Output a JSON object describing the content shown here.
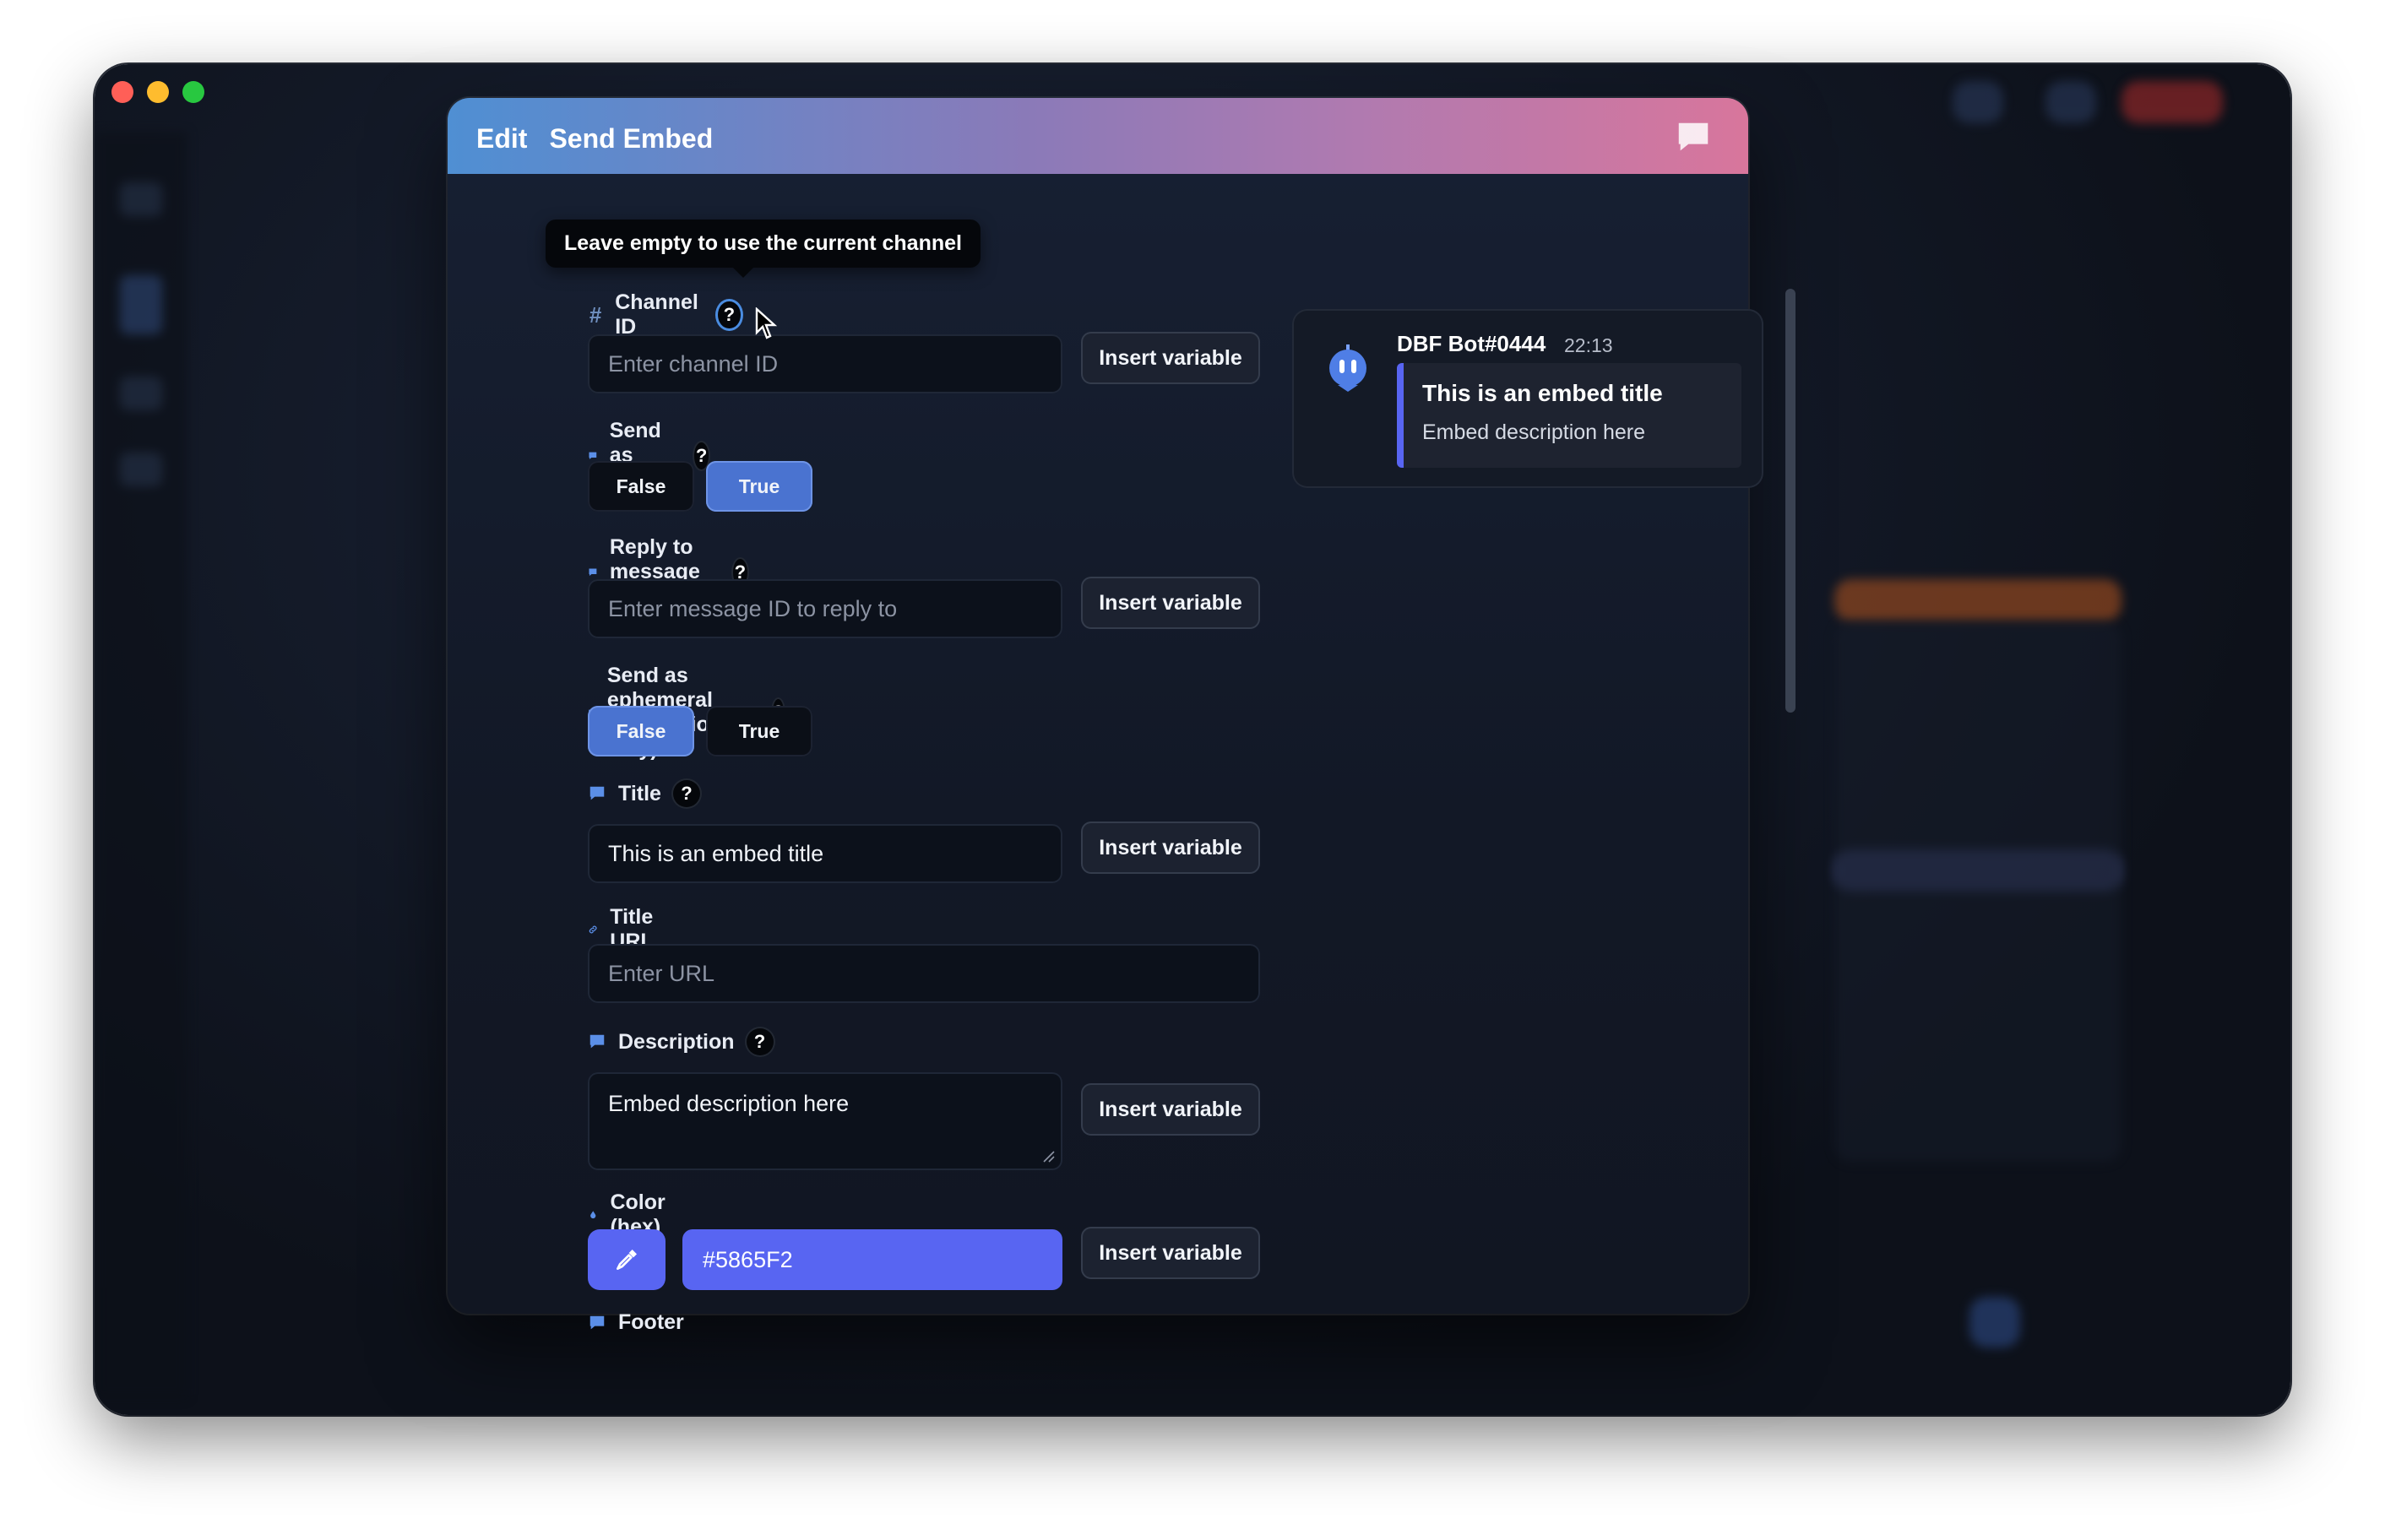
{
  "modal": {
    "title_action": "Edit",
    "title_name": "Send Embed",
    "tooltip": "Leave empty to use the current channel"
  },
  "fields": {
    "channel_id": {
      "label": "Channel ID",
      "placeholder": "Enter channel ID"
    },
    "send_as_reply": {
      "label": "Send as reply",
      "options": [
        "False",
        "True"
      ],
      "selected": "True"
    },
    "reply_message_id": {
      "label": "Reply to message ID",
      "placeholder": "Enter message ID to reply to"
    },
    "ephemeral": {
      "label": "Send as ephemeral (interactions only)",
      "options": [
        "False",
        "True"
      ],
      "selected": "False"
    },
    "title": {
      "label": "Title",
      "value": "This is an embed title"
    },
    "title_url": {
      "label": "Title URL",
      "placeholder": "Enter URL"
    },
    "description": {
      "label": "Description",
      "value": "Embed description here"
    },
    "color": {
      "label": "Color (hex)",
      "value": "#5865F2"
    },
    "footer": {
      "label": "Footer"
    }
  },
  "buttons": {
    "insert_variable": "Insert variable"
  },
  "help_glyph": "?",
  "preview": {
    "bot_name": "DBF Bot#0444",
    "time": "22:13",
    "embed_title": "This is an embed title",
    "embed_description": "Embed description here",
    "embed_color": "#5865F2"
  },
  "icons": {
    "header": "chat-bubble-icon",
    "channel": "hash-icon",
    "field": "chat-bubble-icon",
    "link": "link-icon",
    "color": "droplet-icon",
    "eyedropper": "eyedropper-icon"
  }
}
